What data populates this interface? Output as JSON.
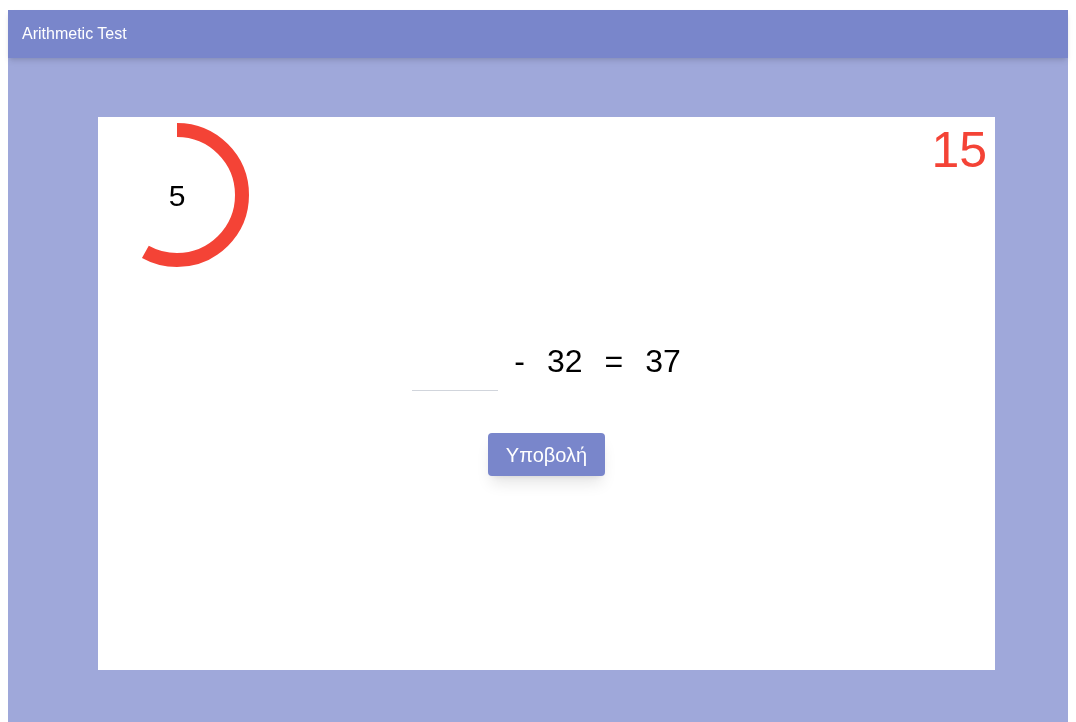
{
  "app_bar": {
    "title": "Arithmetic Test"
  },
  "timer": {
    "value": "5",
    "level": 0.58
  },
  "score": "15",
  "equation": {
    "operator": "-",
    "operand": "32",
    "equals": "=",
    "result": "37"
  },
  "submit_button": "Υποβολή"
}
